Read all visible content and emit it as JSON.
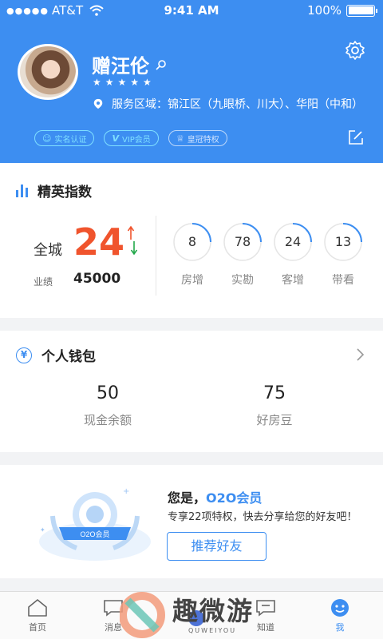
{
  "status_bar": {
    "carrier": "AT&T",
    "time": "9:41 AM",
    "battery": "100%",
    "signal_dots": "●●●●●"
  },
  "profile": {
    "name": "赠汪伦",
    "stars": "★★★★★",
    "service_area": "服务区域：锦江区（九眼桥、川大）、华阳（中和）",
    "badges": [
      {
        "label": "实名认证",
        "icon": "person-icon"
      },
      {
        "label": "VIP会员",
        "icon": "v-icon"
      },
      {
        "label": "皇冠特权",
        "icon": "crown-icon"
      }
    ]
  },
  "elite_index": {
    "title": "精英指数",
    "city_label": "全城",
    "city_value": "24",
    "perf_label": "业绩",
    "perf_value": "45000",
    "metrics": [
      {
        "value": "8",
        "label": "房增"
      },
      {
        "value": "78",
        "label": "实勘"
      },
      {
        "value": "24",
        "label": "客增"
      },
      {
        "value": "13",
        "label": "带看"
      }
    ]
  },
  "wallet": {
    "title": "个人钱包",
    "icon_glyph": "¥",
    "items": [
      {
        "value": "50",
        "label": "现金余额"
      },
      {
        "value": "75",
        "label": "好房豆"
      }
    ]
  },
  "promo": {
    "title_prefix": "您是，",
    "title_highlight": "O2O会员",
    "description": "专享22项特权，快去分享给您的好友吧！",
    "button_label": "推荐好友",
    "medal_label": "O2O会员"
  },
  "tabs": [
    {
      "label": "首页",
      "icon": "home-icon",
      "active": false
    },
    {
      "label": "消息",
      "icon": "message-icon",
      "active": false
    },
    {
      "label": "知道",
      "icon": "knowledge-icon",
      "active": false
    },
    {
      "label": "我",
      "icon": "profile-icon",
      "active": true
    }
  ],
  "watermark": {
    "text": "趣微游",
    "sub": "QUWEIYOU"
  },
  "colors": {
    "primary": "#3d8ef1",
    "accent_red": "#f0542d",
    "arrow_green": "#22a84a"
  }
}
